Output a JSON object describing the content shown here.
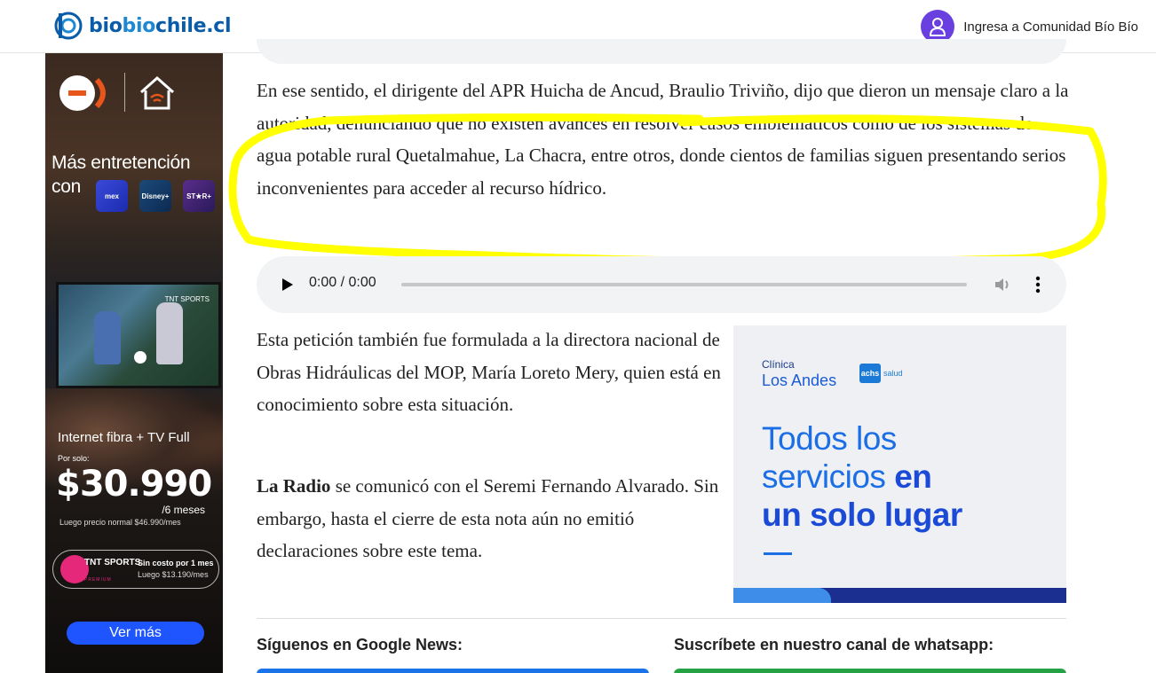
{
  "header": {
    "logo_text_1": "bio",
    "logo_text_2": "bio",
    "logo_text_3": "chile.cl",
    "community_label": "Ingresa a Comunidad Bío Bío",
    "avatar_color": "#6a3fe0"
  },
  "left_ad": {
    "headline_line1": "Más entretención",
    "headline_line2": "con",
    "brand_1": "mex",
    "brand_2": "Disney+",
    "brand_3": "ST★R+",
    "tv_badge": "TNT SPORTS",
    "fiber_text": "Internet fibra + TV Full",
    "por_solo": "Por solo:",
    "price": "$30.990",
    "meses": "/6 meses",
    "luego": "Luego precio normal $46.990/mes",
    "tnt_label": "TNT SPORTS",
    "tnt_sub": "PREMIUM",
    "tnt_cost": "Sin costo por 1 mes",
    "tnt_cost2": "Luego $13.190/mes",
    "cta": "Ver más"
  },
  "article": {
    "para1": "En ese sentido, el dirigente del APR Huicha de Ancud, Braulio Triviño, dijo que dieron un mensaje claro a la autoridad, denunciando que no existen avances en resolver casos emblemáticos como de los sistemas de agua potable rural Quetalmahue, La Chacra, entre otros, donde cientos de familias siguen presentando serios inconvenientes para acceder al recurso hídrico.",
    "highlight_color": "#ffff00",
    "audio_time": "0:00 / 0:00",
    "para2": "Esta petición también fue formulada a la directora nacional de Obras Hidráulicas del MOP, María Loreto Mery, quien está en conocimiento sobre esta situación.",
    "para3_bold": "La Radio",
    "para3_rest": " se comunicó con el Seremi Fernando Alvarado. Sin embargo, hasta el cierre de esta nota aún no emitió declaraciones sobre este tema.",
    "follow_google": "Síguenos en Google News:",
    "follow_whatsapp": "Suscríbete en nuestro canal de whatsapp:"
  },
  "right_ad": {
    "clinica_small": "Clínica",
    "clinica_big": "Los Andes",
    "achs": "achs",
    "achs_salud": "salud",
    "slogan_1": "Todos los",
    "slogan_2a": "servicios ",
    "slogan_2b": "en",
    "slogan_3": "un solo lugar"
  }
}
